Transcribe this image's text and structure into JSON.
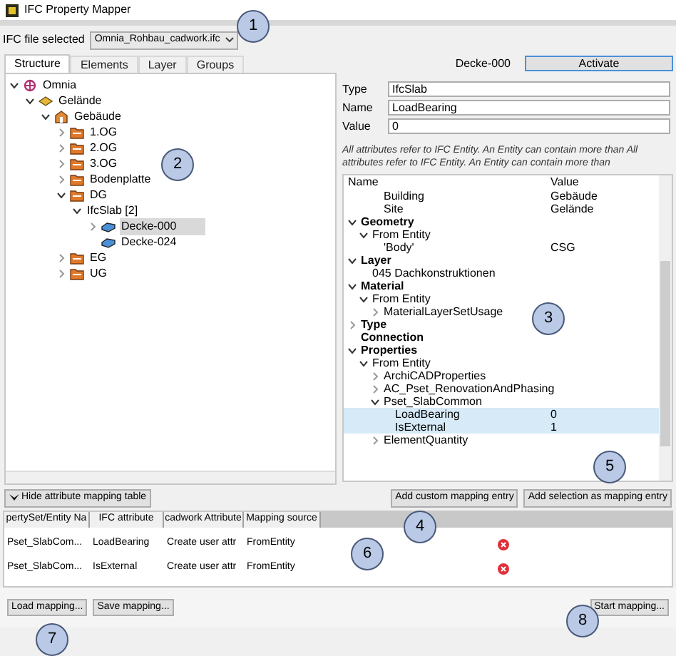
{
  "window": {
    "title": "IFC Property Mapper"
  },
  "file_select": {
    "label": "IFC file selected",
    "value": "Omnia_Rohbau_cadwork.ifc"
  },
  "tabs": [
    {
      "label": "Structure",
      "selected": true
    },
    {
      "label": "Elements",
      "selected": false
    },
    {
      "label": "Layer",
      "selected": false
    },
    {
      "label": "Groups",
      "selected": false
    }
  ],
  "structure_tree": [
    {
      "label": "Omnia",
      "kind": "project",
      "expanded": true,
      "selected": false,
      "children": [
        {
          "label": "Gelände",
          "kind": "site",
          "expanded": true,
          "selected": false,
          "children": [
            {
              "label": "Gebäude",
              "kind": "building",
              "expanded": true,
              "selected": false,
              "children": [
                {
                  "label": "1.OG",
                  "kind": "storey",
                  "expanded": false,
                  "selected": false
                },
                {
                  "label": "2.OG",
                  "kind": "storey",
                  "expanded": false,
                  "selected": false
                },
                {
                  "label": "3.OG",
                  "kind": "storey",
                  "expanded": false,
                  "selected": false
                },
                {
                  "label": "Bodenplatte",
                  "kind": "storey",
                  "expanded": false,
                  "selected": false
                },
                {
                  "label": "DG",
                  "kind": "storey",
                  "expanded": true,
                  "selected": false,
                  "children": [
                    {
                      "label": "IfcSlab [2]",
                      "expanded": true,
                      "selected": false,
                      "children": [
                        {
                          "label": "Decke-000",
                          "kind": "slab",
                          "expanded": false,
                          "selected": true
                        },
                        {
                          "label": "Decke-024",
                          "kind": "slab",
                          "selected": false
                        }
                      ]
                    }
                  ]
                },
                {
                  "label": "EG",
                  "kind": "storey",
                  "expanded": false,
                  "selected": false
                },
                {
                  "label": "UG",
                  "kind": "storey",
                  "expanded": false,
                  "selected": false
                }
              ]
            }
          ]
        }
      ]
    }
  ],
  "element": {
    "name": "Decke-000",
    "activate_button": "Activate"
  },
  "fields": [
    {
      "label": "Type",
      "value": "IfcSlab"
    },
    {
      "label": "Name",
      "value": "LoadBearing"
    },
    {
      "label": "Value",
      "value": "0"
    }
  ],
  "note": "All attributes refer to IFC Entity. An Entity can contain more than All attributes refer to IFC Entity. An Entity can contain more than",
  "property_tree": {
    "columns": [
      "Name",
      "Value"
    ],
    "scrolled_rows": [
      {
        "name": "Building",
        "value": "Gebäude"
      },
      {
        "name": "Site",
        "value": "Gelände"
      }
    ],
    "rows": [
      {
        "name": "Geometry",
        "kind": "category",
        "expanded": true,
        "children": [
          {
            "name": "From Entity",
            "expanded": true,
            "children": [
              {
                "name": "'Body'",
                "value": "CSG"
              }
            ]
          }
        ]
      },
      {
        "name": "Layer",
        "kind": "category",
        "expanded": true,
        "children": [
          {
            "name": "045 Dachkonstruktionen"
          }
        ]
      },
      {
        "name": "Material",
        "kind": "category",
        "expanded": true,
        "children": [
          {
            "name": "From Entity",
            "expanded": true,
            "children": [
              {
                "name": "MaterialLayerSetUsage",
                "expanded": false
              }
            ]
          }
        ]
      },
      {
        "name": "Type",
        "kind": "category",
        "expanded": false
      },
      {
        "name": "Connection",
        "kind": "category"
      },
      {
        "name": "Properties",
        "kind": "category",
        "expanded": true,
        "children": [
          {
            "name": "From Entity",
            "expanded": true,
            "children": [
              {
                "name": "ArchiCADProperties",
                "expanded": false
              },
              {
                "name": "AC_Pset_RenovationAndPhasing",
                "expanded": false
              },
              {
                "name": "Pset_SlabCommon",
                "expanded": true,
                "children": [
                  {
                    "name": "LoadBearing",
                    "value": "0",
                    "selected": true
                  },
                  {
                    "name": "IsExternal",
                    "value": "1",
                    "selected": true
                  }
                ]
              },
              {
                "name": "ElementQuantity",
                "expanded": false
              }
            ]
          }
        ]
      }
    ]
  },
  "buttons_row": {
    "toggle": "Hide attribute mapping table",
    "add_custom": "Add custom mapping entry",
    "add_selection": "Add selection as mapping entry"
  },
  "mapping_table": {
    "columns": [
      "pertySet/Entity Na",
      "IFC attribute",
      "cadwork Attribute",
      "Mapping source"
    ],
    "rows": [
      {
        "cells": [
          "Pset_SlabCom...",
          "LoadBearing",
          "Create user attr",
          "FromEntity"
        ]
      },
      {
        "cells": [
          "Pset_SlabCom...",
          "IsExternal",
          "Create user attr",
          "FromEntity"
        ]
      }
    ]
  },
  "bottom_buttons": [
    "Load mapping...",
    "Save mapping...",
    "Start mapping..."
  ],
  "callouts": [
    "1",
    "2",
    "3",
    "4",
    "5",
    "6",
    "7",
    "8"
  ]
}
